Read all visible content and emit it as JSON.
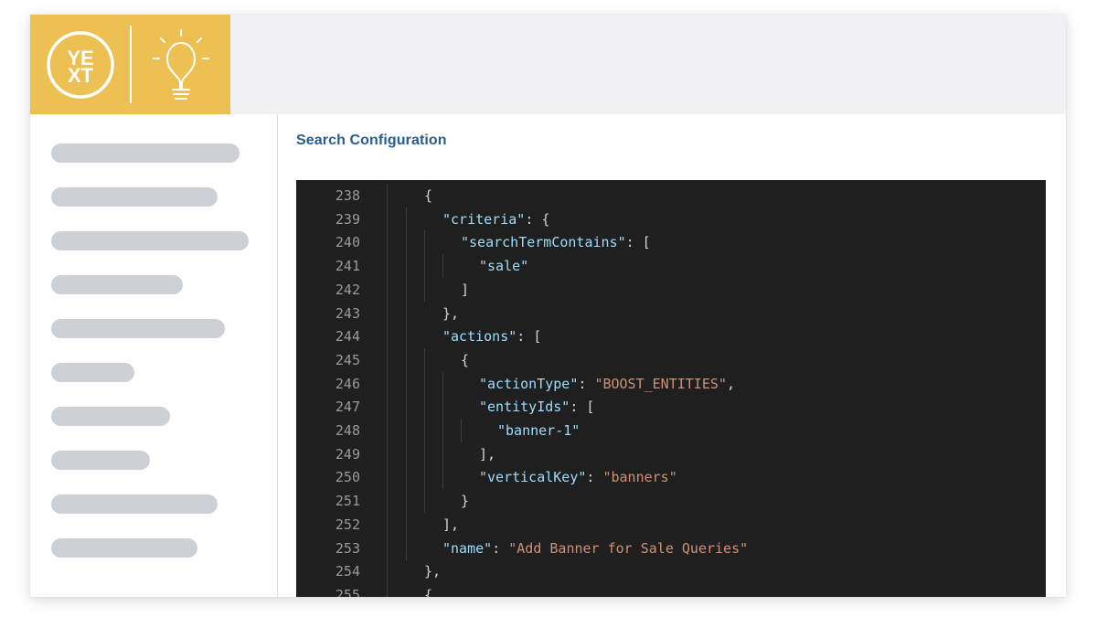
{
  "brand": {
    "logo_text_top": "YE",
    "logo_text_bottom": "XT",
    "logo_icon": "yext-logo-icon",
    "idea_icon": "lightbulb-icon",
    "accent_color": "#ecc052"
  },
  "sidebar": {
    "placeholder_count": 10,
    "placeholder_color": "#cdd0d4"
  },
  "main": {
    "section_title": "Search Configuration"
  },
  "editor": {
    "lines": [
      {
        "num": "238",
        "indent": 0,
        "tokens": [
          {
            "t": "{",
            "c": "punc"
          }
        ]
      },
      {
        "num": "239",
        "indent": 1,
        "tokens": [
          {
            "t": "\"criteria\"",
            "c": "key"
          },
          {
            "t": ": {",
            "c": "punc"
          }
        ]
      },
      {
        "num": "240",
        "indent": 2,
        "tokens": [
          {
            "t": "\"searchTermContains\"",
            "c": "key"
          },
          {
            "t": ": [",
            "c": "punc"
          }
        ]
      },
      {
        "num": "241",
        "indent": 3,
        "tokens": [
          {
            "t": "\"sale\"",
            "c": "key"
          }
        ]
      },
      {
        "num": "242",
        "indent": 2,
        "tokens": [
          {
            "t": "]",
            "c": "punc"
          }
        ]
      },
      {
        "num": "243",
        "indent": 1,
        "tokens": [
          {
            "t": "},",
            "c": "punc"
          }
        ]
      },
      {
        "num": "244",
        "indent": 1,
        "tokens": [
          {
            "t": "\"actions\"",
            "c": "key"
          },
          {
            "t": ": [",
            "c": "punc"
          }
        ]
      },
      {
        "num": "245",
        "indent": 2,
        "tokens": [
          {
            "t": "{",
            "c": "punc"
          }
        ]
      },
      {
        "num": "246",
        "indent": 3,
        "tokens": [
          {
            "t": "\"actionType\"",
            "c": "key"
          },
          {
            "t": ": ",
            "c": "punc"
          },
          {
            "t": "\"BOOST_ENTITIES\"",
            "c": "str"
          },
          {
            "t": ",",
            "c": "punc"
          }
        ]
      },
      {
        "num": "247",
        "indent": 3,
        "tokens": [
          {
            "t": "\"entityIds\"",
            "c": "key"
          },
          {
            "t": ": [",
            "c": "punc"
          }
        ]
      },
      {
        "num": "248",
        "indent": 4,
        "tokens": [
          {
            "t": "\"banner-1\"",
            "c": "key"
          }
        ]
      },
      {
        "num": "249",
        "indent": 3,
        "tokens": [
          {
            "t": "],",
            "c": "punc"
          }
        ]
      },
      {
        "num": "250",
        "indent": 3,
        "tokens": [
          {
            "t": "\"verticalKey\"",
            "c": "key"
          },
          {
            "t": ": ",
            "c": "punc"
          },
          {
            "t": "\"banners\"",
            "c": "str"
          }
        ]
      },
      {
        "num": "251",
        "indent": 2,
        "tokens": [
          {
            "t": "}",
            "c": "punc"
          }
        ]
      },
      {
        "num": "252",
        "indent": 1,
        "tokens": [
          {
            "t": "],",
            "c": "punc"
          }
        ]
      },
      {
        "num": "253",
        "indent": 1,
        "tokens": [
          {
            "t": "\"name\"",
            "c": "key"
          },
          {
            "t": ": ",
            "c": "punc"
          },
          {
            "t": "\"Add Banner for Sale Queries\"",
            "c": "str"
          }
        ]
      },
      {
        "num": "254",
        "indent": 0,
        "tokens": [
          {
            "t": "},",
            "c": "punc"
          }
        ]
      },
      {
        "num": "255",
        "indent": 0,
        "tokens": [
          {
            "t": "{",
            "c": "punc"
          }
        ]
      }
    ]
  }
}
